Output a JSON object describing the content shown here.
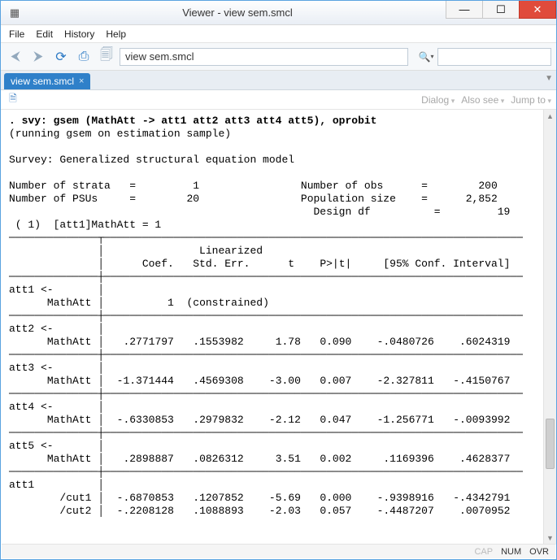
{
  "window": {
    "title": "Viewer - view sem.smcl"
  },
  "menu": {
    "file": "File",
    "edit": "Edit",
    "history": "History",
    "help": "Help"
  },
  "toolbar": {
    "address_value": "view sem.smcl"
  },
  "tab": {
    "label": "view sem.smcl",
    "close": "×"
  },
  "sublinks": {
    "dialog": "Dialog",
    "alsosee": "Also see",
    "jumpto": "Jump to"
  },
  "output": {
    "cmd": ". svy: gsem (MathAtt -> att1 att2 att3 att4 att5), oprobit",
    "note": "(running gsem on estimation sample)",
    "survey": "Survey: Generalized structural equation model",
    "strata_lbl": "Number of strata   =",
    "strata_val": "1",
    "psu_lbl": "Number of PSUs     =",
    "psu_val": "20",
    "nobs_lbl": "Number of obs      =",
    "nobs_val": "200",
    "pop_lbl": "Population size    =",
    "pop_val": "2,852",
    "df_lbl": "Design df          =",
    "df_val": "19",
    "constraint": " ( 1)  [att1]MathAtt = 1",
    "hdr_lin": "Linearized",
    "hdr_coef": "Coef.",
    "hdr_se": "Std. Err.",
    "hdr_t": "t",
    "hdr_p": "P>|t|",
    "hdr_ci": "[95% Conf. Interval]",
    "rows": {
      "att1": {
        "label": "att1 <-",
        "sub": "MathAtt",
        "coef": "1",
        "note": "(constrained)"
      },
      "att2": {
        "label": "att2 <-",
        "sub": "MathAtt",
        "coef": ".2771797",
        "se": ".1553982",
        "t": "1.78",
        "p": "0.090",
        "lo": "-.0480726",
        "hi": ".6024319"
      },
      "att3": {
        "label": "att3 <-",
        "sub": "MathAtt",
        "coef": "-1.371444",
        "se": ".4569308",
        "t": "-3.00",
        "p": "0.007",
        "lo": "-2.327811",
        "hi": "-.4150767"
      },
      "att4": {
        "label": "att4 <-",
        "sub": "MathAtt",
        "coef": "-.6330853",
        "se": ".2979832",
        "t": "-2.12",
        "p": "0.047",
        "lo": "-1.256771",
        "hi": "-.0093992"
      },
      "att5": {
        "label": "att5 <-",
        "sub": "MathAtt",
        "coef": ".2898887",
        "se": ".0826312",
        "t": "3.51",
        "p": "0.002",
        "lo": ".1169396",
        "hi": ".4628377"
      },
      "cut1": {
        "label": "att1",
        "sub": "/cut1",
        "coef": "-.6870853",
        "se": ".1207852",
        "t": "-5.69",
        "p": "0.000",
        "lo": "-.9398916",
        "hi": "-.4342791"
      },
      "cut2": {
        "sub": "/cut2",
        "coef": "-.2208128",
        "se": ".1088893",
        "t": "-2.03",
        "p": "0.057",
        "lo": "-.4487207",
        "hi": ".0070952"
      }
    }
  },
  "status": {
    "cap": "CAP",
    "num": "NUM",
    "ovr": "OVR"
  }
}
